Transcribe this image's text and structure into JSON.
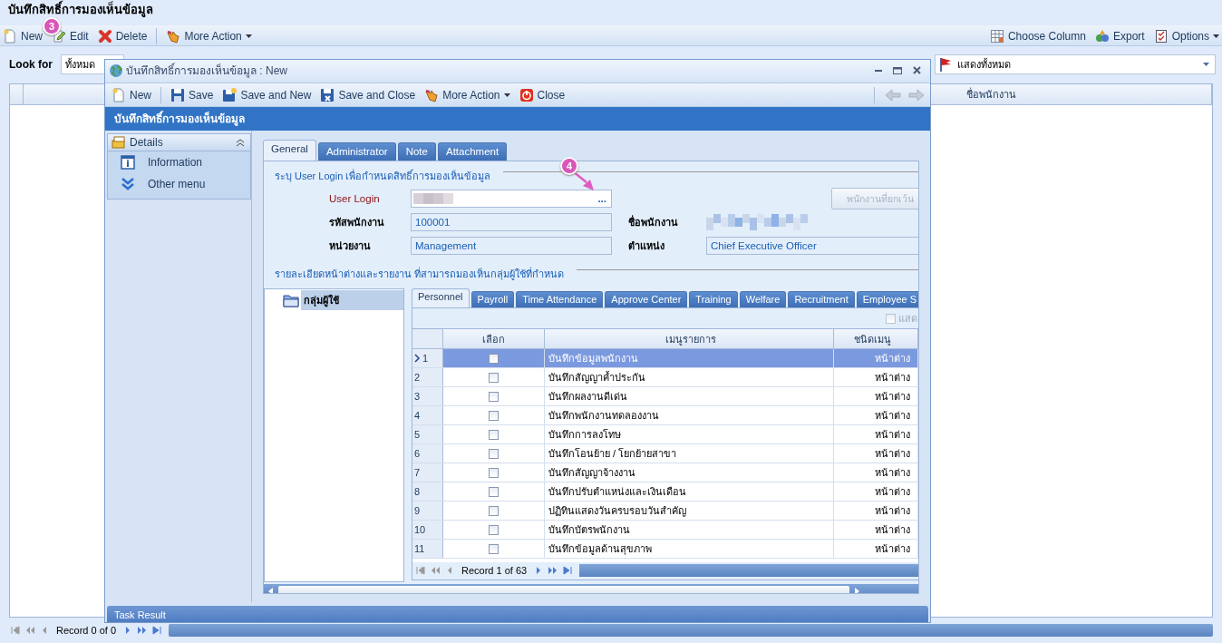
{
  "page": {
    "title": "บันทึกสิทธิ์การมองเห็นข้อมูล",
    "toolbar_left": [
      {
        "label": "New",
        "kind": "new",
        "dropdown": false
      },
      {
        "label": "Edit",
        "kind": "edit",
        "dropdown": false
      },
      {
        "label": "Delete",
        "kind": "delete",
        "dropdown": false
      },
      {
        "label": "More Action",
        "kind": "action",
        "dropdown": true
      }
    ],
    "toolbar_right": [
      {
        "label": "Choose Column",
        "kind": "columns",
        "dropdown": false
      },
      {
        "label": "Export",
        "kind": "export",
        "dropdown": false
      },
      {
        "label": "Options",
        "kind": "options",
        "dropdown": true
      }
    ],
    "look_for": {
      "label": "Look for",
      "value": "ทั้งหมด"
    },
    "filter": {
      "value": "แสดงทั้งหมด"
    },
    "grid": {
      "columns": [
        "ชื่อพนักงาน"
      ]
    },
    "navigator": {
      "text": "Record 0 of 0"
    }
  },
  "annotations": [
    {
      "label": "3"
    },
    {
      "label": "4"
    }
  ],
  "dialog": {
    "title": "บันทึกสิทธิ์การมองเห็นข้อมูล : New",
    "toolbar": [
      {
        "label": "New",
        "kind": "new",
        "dropdown": false
      },
      {
        "label": "Save",
        "kind": "save",
        "dropdown": false
      },
      {
        "label": "Save and New",
        "kind": "save-new",
        "dropdown": false
      },
      {
        "label": "Save and Close",
        "kind": "save-close",
        "dropdown": false
      },
      {
        "label": "More Action",
        "kind": "action",
        "dropdown": true
      },
      {
        "label": "Close",
        "kind": "close",
        "dropdown": false
      }
    ],
    "header": "บันทึกสิทธิ์การมองเห็นข้อมูล",
    "sidebar": {
      "header": "Details",
      "items": [
        {
          "label": "Information",
          "kind": "info"
        },
        {
          "label": "Other menu",
          "kind": "more"
        }
      ]
    },
    "tabs": [
      {
        "label": "General",
        "selected": true
      },
      {
        "label": "Administrator",
        "selected": false
      },
      {
        "label": "Note",
        "selected": false
      },
      {
        "label": "Attachment",
        "selected": false
      }
    ],
    "section_1": "ระบุ User Login เพื่อกำหนดสิทธิ์การมองเห็นข้อมูล",
    "user_login": {
      "label": "User Login",
      "required": true,
      "redacted": true,
      "button": "..."
    },
    "exclude_button": {
      "label": "พนักงานที่ยกเว้น",
      "disabled": true
    },
    "fields": [
      {
        "label": "รหัสพนักงาน",
        "value": "100001",
        "redacted": false
      },
      {
        "label": "ชื่อพนักงาน",
        "redacted": true
      },
      {
        "label": "หน่วยงาน",
        "value": "Management",
        "redacted": false
      },
      {
        "label": "ตำแหน่ง",
        "value": "Chief Executive Officer",
        "redacted": false
      }
    ],
    "section_2": "รายละเอียดหน้าต่างและรายงาน ที่สามารถมองเห็นกลุ่มผู้ใช้ที่กำหนด",
    "tree": [
      {
        "label": "กลุ่มผู้ใช้",
        "selected": true
      }
    ],
    "inner_tabs": [
      {
        "label": "Personnel",
        "selected": true
      },
      {
        "label": "Payroll",
        "selected": false
      },
      {
        "label": "Time Attendance",
        "selected": false
      },
      {
        "label": "Approve Center",
        "selected": false
      },
      {
        "label": "Training",
        "selected": false
      },
      {
        "label": "Welfare",
        "selected": false
      },
      {
        "label": "Recruitment",
        "selected": false
      },
      {
        "label": "Employee S",
        "selected": false
      }
    ],
    "show_all": {
      "label": "แสด",
      "checked": false
    },
    "table": {
      "columns": [
        "เลือก",
        "เมนูรายการ",
        "ชนิดเมนู"
      ],
      "rows": [
        {
          "number": "1",
          "checked": false,
          "menu": "บันทึกข้อมูลพนักงาน",
          "type": "หน้าต่าง",
          "selected": true
        },
        {
          "number": "2",
          "checked": false,
          "menu": "บันทึกสัญญาค้ำประกัน",
          "type": "หน้าต่าง",
          "selected": false
        },
        {
          "number": "3",
          "checked": false,
          "menu": "บันทึกผลงานดีเด่น",
          "type": "หน้าต่าง",
          "selected": false
        },
        {
          "number": "4",
          "checked": false,
          "menu": "บันทึกพนักงานทดลองงาน",
          "type": "หน้าต่าง",
          "selected": false
        },
        {
          "number": "5",
          "checked": false,
          "menu": "บันทึกการลงโทษ",
          "type": "หน้าต่าง",
          "selected": false
        },
        {
          "number": "6",
          "checked": false,
          "menu": "บันทึกโอนย้าย / โยกย้ายสาขา",
          "type": "หน้าต่าง",
          "selected": false
        },
        {
          "number": "7",
          "checked": false,
          "menu": "บันทึกสัญญาจ้างงาน",
          "type": "หน้าต่าง",
          "selected": false
        },
        {
          "number": "8",
          "checked": false,
          "menu": "บันทึกปรับตำแหน่งและเงินเดือน",
          "type": "หน้าต่าง",
          "selected": false
        },
        {
          "number": "9",
          "checked": false,
          "menu": "ปฏิทินแสดงวันครบรอบวันสำคัญ",
          "type": "หน้าต่าง",
          "selected": false
        },
        {
          "number": "10",
          "checked": false,
          "menu": "บันทึกบัตรพนักงาน",
          "type": "หน้าต่าง",
          "selected": false
        },
        {
          "number": "11",
          "checked": false,
          "menu": "บันทึกข้อมูลด้านสุขภาพ",
          "type": "หน้าต่าง",
          "selected": false
        }
      ]
    },
    "navigator": {
      "text": "Record 1 of 63"
    },
    "task_result": "Task Result"
  }
}
